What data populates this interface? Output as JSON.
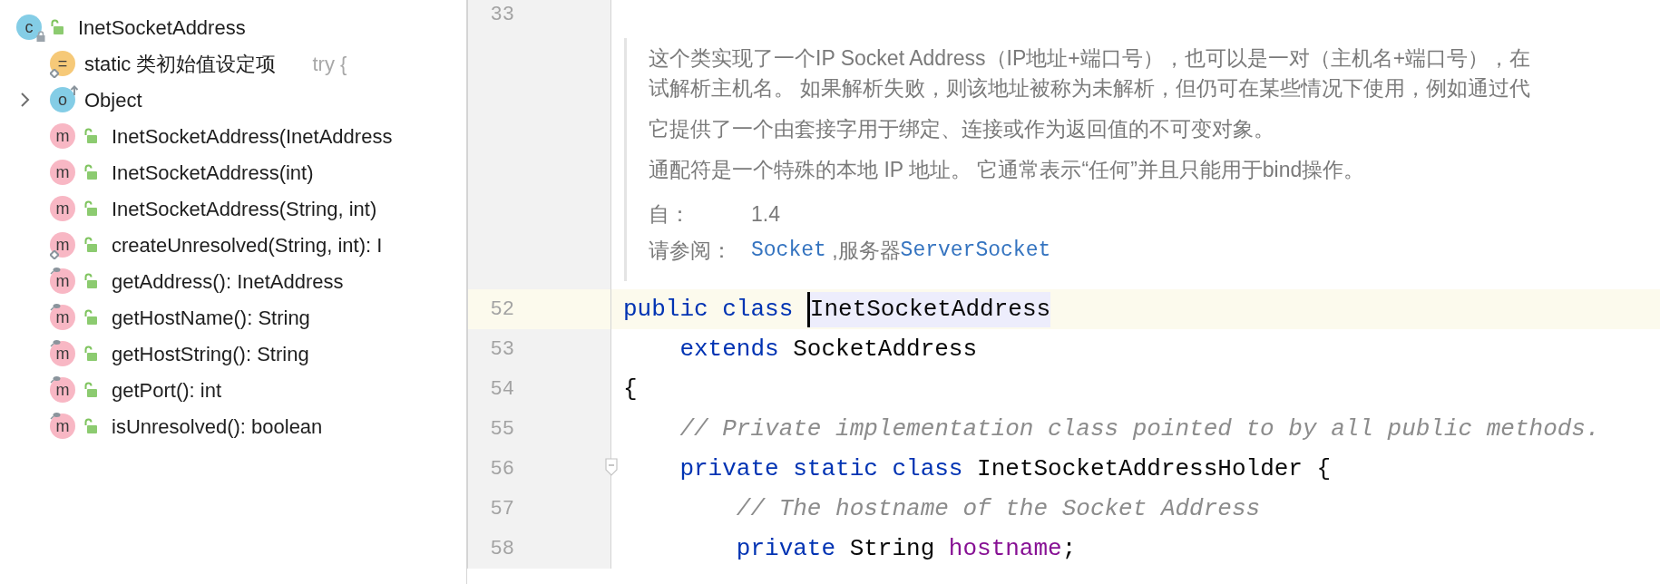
{
  "structure": {
    "items": [
      {
        "kind": "class",
        "badge": "c",
        "label": "InetSocketAddress",
        "final": true,
        "public": true,
        "children": [
          {
            "kind": "initializer",
            "badge": "=",
            "label": "static 类初始值设定项",
            "hint": "try {",
            "static": true,
            "public": false
          },
          {
            "kind": "parent",
            "badge": "o",
            "label": "Object",
            "expanded": false,
            "public": false
          },
          {
            "kind": "method",
            "badge": "m",
            "label": "InetSocketAddress(InetAddress",
            "static": false,
            "overrides": false,
            "public": true
          },
          {
            "kind": "method",
            "badge": "m",
            "label": "InetSocketAddress(int)",
            "static": false,
            "overrides": false,
            "public": true
          },
          {
            "kind": "method",
            "badge": "m",
            "label": "InetSocketAddress(String, int)",
            "static": false,
            "overrides": false,
            "public": true
          },
          {
            "kind": "method",
            "badge": "m",
            "label": "createUnresolved(String, int): I",
            "static": true,
            "overrides": false,
            "public": true
          },
          {
            "kind": "method",
            "badge": "m",
            "label": "getAddress(): InetAddress",
            "static": false,
            "overrides": true,
            "public": true
          },
          {
            "kind": "method",
            "badge": "m",
            "label": "getHostName(): String",
            "static": false,
            "overrides": true,
            "public": true
          },
          {
            "kind": "method",
            "badge": "m",
            "label": "getHostString(): String",
            "static": false,
            "overrides": true,
            "public": true
          },
          {
            "kind": "method",
            "badge": "m",
            "label": "getPort(): int",
            "static": false,
            "overrides": true,
            "public": true
          },
          {
            "kind": "method",
            "badge": "m",
            "label": "isUnresolved(): boolean",
            "static": false,
            "overrides": true,
            "public": true
          }
        ]
      }
    ]
  },
  "editor": {
    "top_line": "33",
    "doc": {
      "paragraphs": [
        {
          "lines": [
            "这个类实现了一个IP Socket Address（IP地址+端口号），也可以是一对（主机名+端口号），在",
            "试解析主机名。 如果解析失败，则该地址被称为未解析，但仍可在某些情况下使用，例如通过代"
          ]
        },
        {
          "lines": [
            "它提供了一个由套接字用于绑定、连接或作为返回值的不可变对象。"
          ]
        },
        {
          "lines": [
            "通配符是一个特殊的本地 IP 地址。 它通常表示“任何”并且只能用于bind操作。"
          ]
        }
      ],
      "since": {
        "label": "自：",
        "value": "1.4"
      },
      "see_also": {
        "label": "请参阅：",
        "parts": [
          {
            "kind": "link",
            "text": "Socket"
          },
          {
            "kind": "text",
            "text": " ,服务器"
          },
          {
            "kind": "link",
            "text": "ServerSocket"
          }
        ]
      }
    },
    "code_lines": [
      {
        "number": "52",
        "current": true,
        "tokens": [
          {
            "kind": "keyword",
            "text": "public class "
          },
          {
            "kind": "plain",
            "text": "InetSocketAddress",
            "caret": true,
            "highlighted": true
          }
        ]
      },
      {
        "number": "53",
        "current": false,
        "tokens": [
          {
            "kind": "keyword",
            "text": "    extends "
          },
          {
            "kind": "plain",
            "text": "SocketAddress"
          }
        ]
      },
      {
        "number": "54",
        "current": false,
        "tokens": [
          {
            "kind": "plain",
            "text": "{"
          }
        ]
      },
      {
        "number": "55",
        "current": false,
        "tokens": [
          {
            "kind": "comment",
            "text": "    // Private implementation class pointed to by all public methods."
          }
        ]
      },
      {
        "number": "56",
        "current": false,
        "foldable": true,
        "tokens": [
          {
            "kind": "keyword",
            "text": "    private static class "
          },
          {
            "kind": "plain",
            "text": "InetSocketAddressHolder {"
          }
        ]
      },
      {
        "number": "57",
        "current": false,
        "tokens": [
          {
            "kind": "comment",
            "text": "        // The hostname of the Socket Address"
          }
        ]
      },
      {
        "number": "58",
        "current": false,
        "tokens": [
          {
            "kind": "keyword",
            "text": "        private "
          },
          {
            "kind": "plain",
            "text": "String "
          },
          {
            "kind": "field",
            "text": "hostname"
          },
          {
            "kind": "plain",
            "text": ";"
          }
        ]
      }
    ]
  }
}
